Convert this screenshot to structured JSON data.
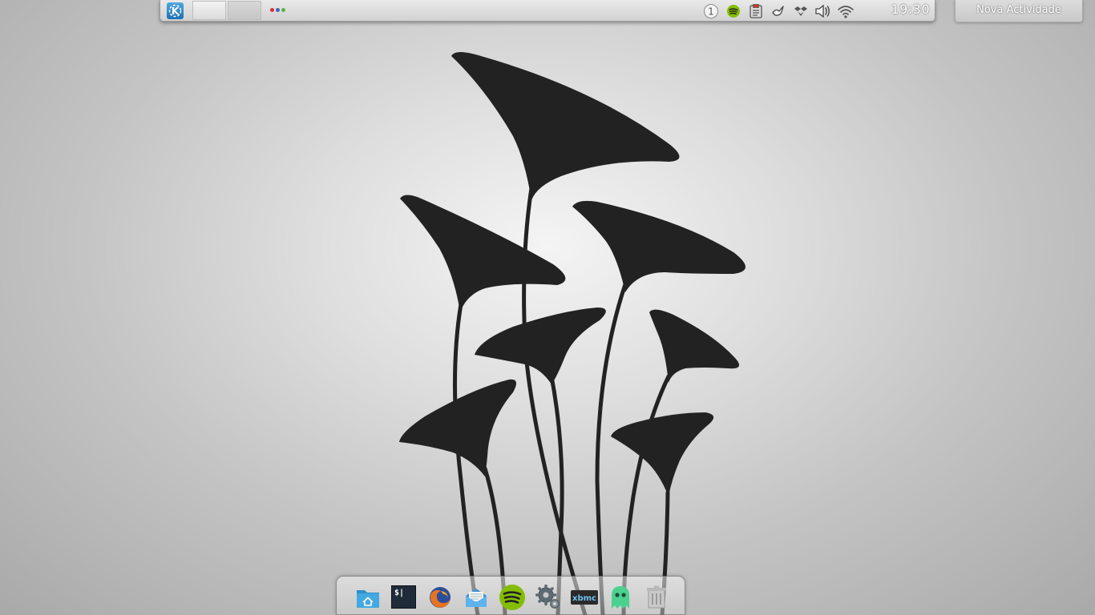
{
  "panel": {
    "launcher_icon": "kde-kickoff-icon",
    "pager_desktops": 2,
    "activity_dot_colors": [
      "#d9302c",
      "#3a65c9",
      "#5cb53d"
    ],
    "tray_icons": [
      "info-icon",
      "spotify-icon",
      "clipboard-icon",
      "notification-bird-icon",
      "dropbox-icon",
      "volume-icon",
      "wifi-icon"
    ],
    "clock": "19:30"
  },
  "activity_button": {
    "label": "Nova Actividade"
  },
  "dock": {
    "items": [
      "home-folder-icon",
      "terminal-icon",
      "firefox-icon",
      "mail-icon",
      "spotify-icon",
      "settings-icon",
      "xbmc-icon",
      "ghost-icon",
      "trash-icon"
    ],
    "terminal_label": "$|",
    "xbmc_label": "xbmc"
  },
  "colors": {
    "wallpaper_art": "#222222",
    "spotify_green": "#84bd00"
  }
}
